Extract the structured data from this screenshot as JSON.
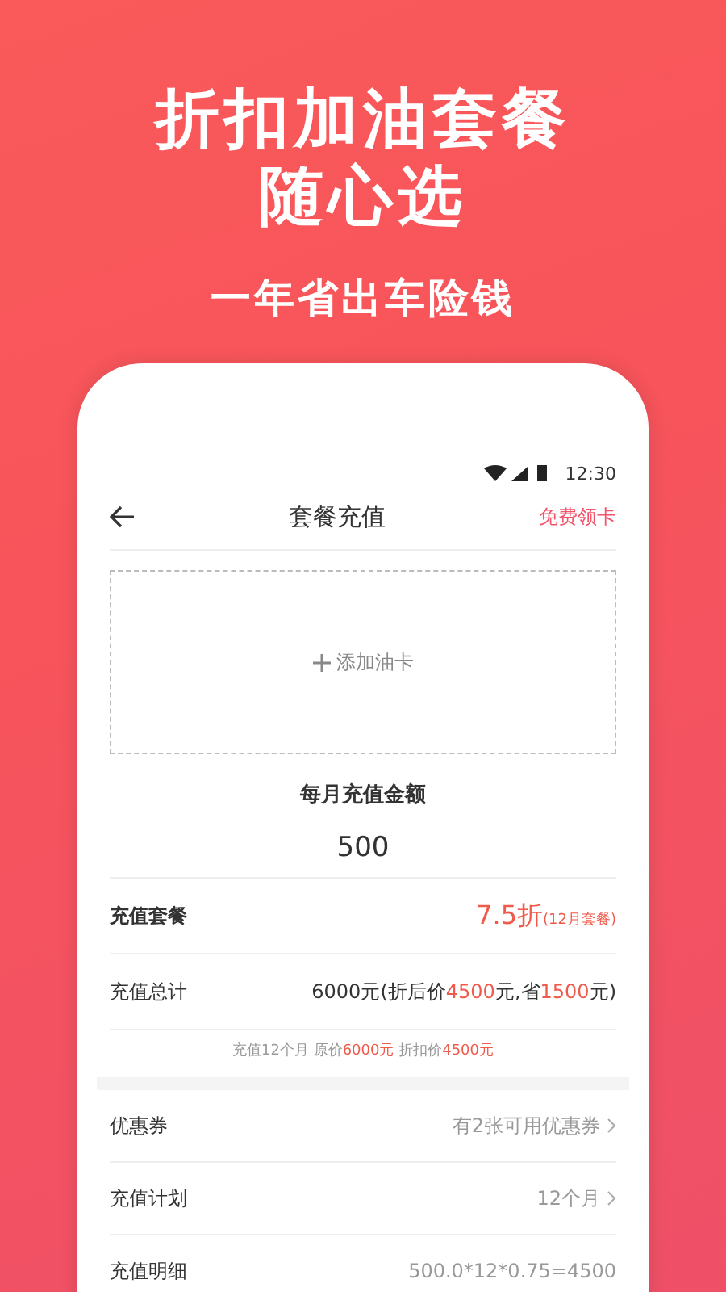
{
  "headline": {
    "lines": [
      "折扣加油套餐",
      "随心选"
    ],
    "subtitle": "一年省出车险钱"
  },
  "status_bar": {
    "time": "12:30"
  },
  "nav": {
    "title": "套餐充值",
    "action": "免费领卡"
  },
  "add_card": {
    "label": "添加油卡"
  },
  "amount": {
    "label": "每月充值金额",
    "value": "500"
  },
  "package": {
    "label": "充值套餐",
    "discount": "7.5折",
    "note": "(12月套餐)"
  },
  "total": {
    "label": "充值总计",
    "segments": [
      {
        "text": "6000元(折后价",
        "highlight": false
      },
      {
        "text": "4500",
        "highlight": true
      },
      {
        "text": "元,省",
        "highlight": false
      },
      {
        "text": "1500",
        "highlight": true
      },
      {
        "text": "元)",
        "highlight": false
      }
    ]
  },
  "summary": [
    {
      "text": "充值12个月 原价",
      "highlight": false
    },
    {
      "text": "6000元",
      "highlight": true
    },
    {
      "text": " 折扣价",
      "highlight": false
    },
    {
      "text": "4500元",
      "highlight": true
    }
  ],
  "rows": [
    {
      "label": "优惠券",
      "value": "有2张可用优惠券",
      "chevron": true
    },
    {
      "label": "充值计划",
      "value": "12个月",
      "chevron": true
    },
    {
      "label": "充值明细",
      "value": "500.0*12*0.75=4500",
      "chevron": false
    }
  ]
}
